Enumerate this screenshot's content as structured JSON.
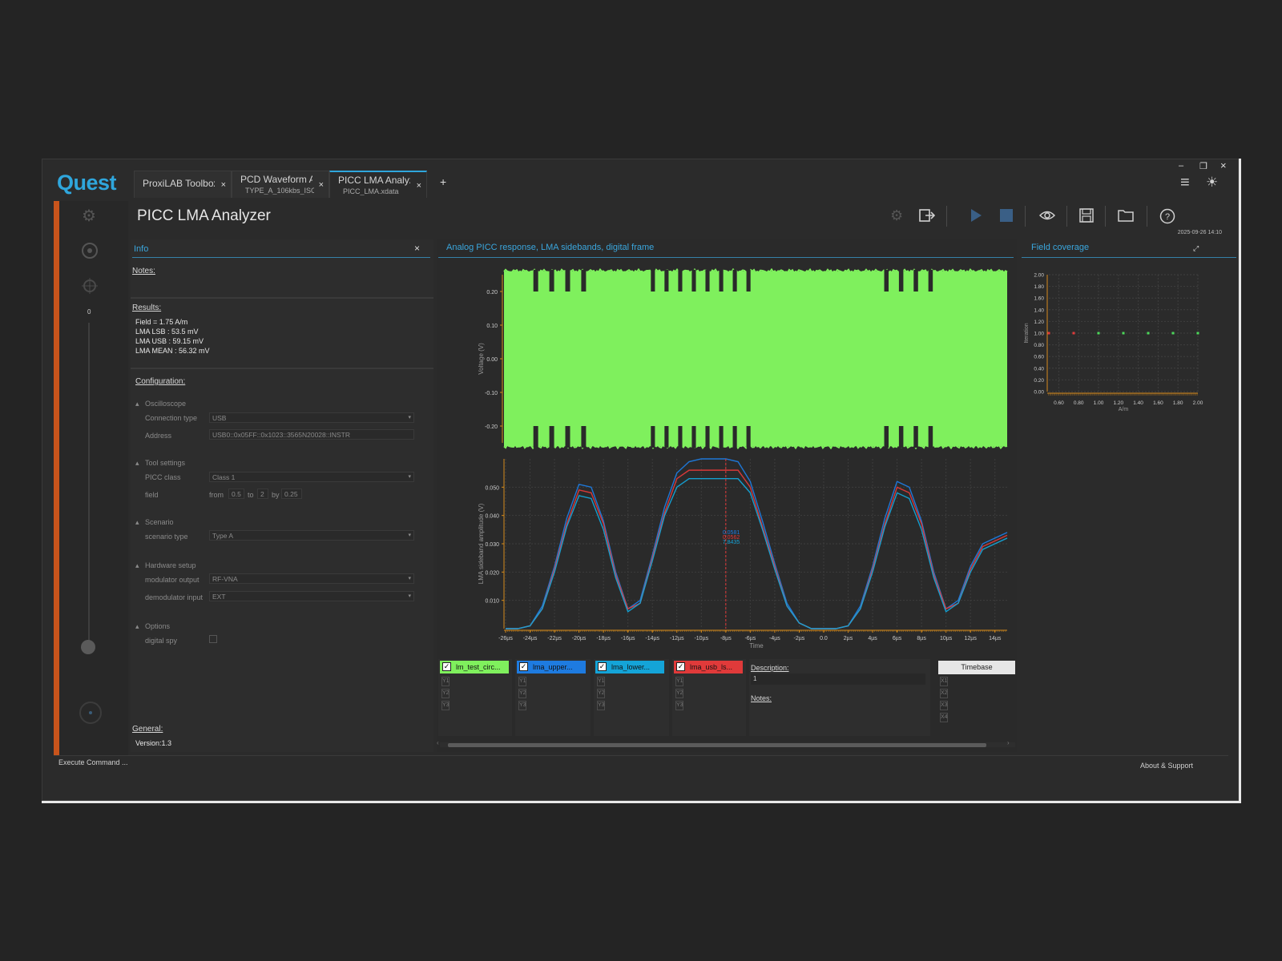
{
  "app": {
    "logo": "Quest",
    "tabs": [
      {
        "title": "ProxiLAB Toolbox",
        "subtitle": "",
        "close": "×"
      },
      {
        "title": "PCD Waveform A",
        "subtitle": "TYPE_A_106kbs_ISO_",
        "close": "×"
      },
      {
        "title": "PICC LMA Analyz",
        "subtitle": "PICC_LMA.xdata",
        "close": "×"
      }
    ],
    "add_tab": "+",
    "window": {
      "minimize": "–",
      "restore": "❐",
      "close": "×"
    },
    "menu_icon": "≡",
    "theme_icon": "☀"
  },
  "page": {
    "title": "PICC LMA Analyzer",
    "timestamp": "2025-09-26 14:10"
  },
  "toolbar": {
    "icons": [
      "gear-icon",
      "export-icon",
      "play-icon",
      "stop-icon",
      "eye-icon",
      "save-icon",
      "folder-icon",
      "help-icon"
    ]
  },
  "rail": {
    "slider_value": "0"
  },
  "info": {
    "title": "Info",
    "close": "×",
    "notes_label": "Notes:",
    "results_label": "Results:",
    "results": [
      "Field = 1.75 A/m",
      "LMA LSB : 53.5 mV",
      "LMA USB : 59.15 mV",
      "LMA MEAN : 56.32 mV"
    ],
    "configuration_label": "Configuration:",
    "oscilloscope": {
      "group": "Oscilloscope",
      "connection_type_label": "Connection type",
      "connection_type": "USB",
      "address_label": "Address",
      "address": "USB0::0x05FF::0x1023::3565N20028::INSTR"
    },
    "tool_settings": {
      "group": "Tool settings",
      "picc_class_label": "PICC class",
      "picc_class": "Class 1",
      "field_label": "field",
      "from_label": "from",
      "from": "0.5",
      "to_label": "to",
      "to": "2",
      "by_label": "by",
      "by": "0.25"
    },
    "scenario": {
      "group": "Scenario",
      "type_label": "scenario type",
      "type": "Type A"
    },
    "hardware": {
      "group": "Hardware setup",
      "mod_label": "modulator output",
      "mod": "RF-VNA",
      "demod_label": "demodulator input",
      "demod": "EXT"
    },
    "options": {
      "group": "Options",
      "spy_label": "digital spy"
    },
    "general_label": "General:",
    "version": "Version:1.3"
  },
  "chart_panel": {
    "title": "Analog PICC response, LMA sidebands, digital frame"
  },
  "field_panel": {
    "title": "Field coverage"
  },
  "legend": {
    "series": [
      {
        "name": "lm_test_circ...",
        "color": "#7ff05d",
        "ys": [
          "Y1",
          "Y2",
          "Y3"
        ]
      },
      {
        "name": "lma_upper...",
        "color": "#1e7be0",
        "ys": [
          "Y1",
          "Y2",
          "Y3"
        ]
      },
      {
        "name": "lma_lower...",
        "color": "#14a4d8",
        "ys": [
          "Y1",
          "Y2",
          "Y3"
        ]
      },
      {
        "name": "lma_usb_ls...",
        "color": "#e03a3a",
        "ys": [
          "Y1",
          "Y2",
          "Y3"
        ]
      }
    ],
    "description_label": "Description:",
    "description": "1",
    "notes_label": "Notes:",
    "timebase": "Timebase",
    "xs": [
      "X1",
      "X2",
      "X3",
      "X4"
    ]
  },
  "status": {
    "command": "Execute Command ...",
    "about": "About & Support"
  },
  "chart_data": [
    {
      "type": "area",
      "title": "",
      "ylabel": "Voltage (V)",
      "ylim": [
        -0.25,
        0.25
      ],
      "yticks": [
        "0.20",
        "0.10",
        "0.00",
        "-0.10",
        "-0.20"
      ],
      "yticks_values": [
        0.2,
        0.1,
        0.0,
        -0.1,
        -0.2
      ],
      "envelope_top": 0.26,
      "envelope_bottom": -0.26,
      "notch_top": 0.2,
      "notch_bottom": -0.2,
      "notch_clusters": [
        {
          "x_start": -23.8,
          "x_end": -18.6,
          "count": 4
        },
        {
          "x_start": -14.2,
          "x_end": -5.3,
          "count": 8
        },
        {
          "x_start": 4.8,
          "x_end": 9.6,
          "count": 4
        }
      ],
      "series": [
        {
          "name": "lm_test_circ...",
          "color": "#7ff05d"
        }
      ]
    },
    {
      "type": "line",
      "xlabel": "Time",
      "ylabel": "LMA sideband amplitude (V)",
      "ylim": [
        0,
        0.06
      ],
      "xlim": [
        -26,
        15
      ],
      "x_ticks": [
        "-26µs",
        "-24µs",
        "-22µs",
        "-20µs",
        "-18µs",
        "-16µs",
        "-14µs",
        "-12µs",
        "-10µs",
        "-8µs",
        "-6µs",
        "-4µs",
        "-2µs",
        "0.0",
        "2µs",
        "4µs",
        "6µs",
        "8µs",
        "10µs",
        "12µs",
        "14µs"
      ],
      "x_ticks_values": [
        -26,
        -24,
        -22,
        -20,
        -18,
        -16,
        -14,
        -12,
        -10,
        -8,
        -6,
        -4,
        -2,
        0,
        2,
        4,
        6,
        8,
        10,
        12,
        14
      ],
      "y_ticks": [
        "0.050",
        "0.040",
        "0.030",
        "0.020",
        "0.010"
      ],
      "y_ticks_values": [
        0.05,
        0.04,
        0.03,
        0.02,
        0.01
      ],
      "cursor_x": -8,
      "cursor_labels": [
        "0.0581",
        "0.0562",
        "7.8435"
      ],
      "x": [
        -26,
        -25,
        -24,
        -23,
        -22,
        -21,
        -20,
        -19,
        -18,
        -17,
        -16,
        -15,
        -14,
        -13,
        -12,
        -11,
        -10,
        -9,
        -8,
        -7,
        -6,
        -5,
        -4,
        -3,
        -2,
        -1,
        0,
        1,
        2,
        3,
        4,
        5,
        6,
        7,
        8,
        9,
        10,
        11,
        12,
        13,
        14,
        15
      ],
      "series": [
        {
          "name": "lma_upper...",
          "color": "#1e7be0",
          "values": [
            0.0,
            0.0,
            0.001,
            0.008,
            0.022,
            0.039,
            0.051,
            0.05,
            0.038,
            0.02,
            0.007,
            0.01,
            0.026,
            0.043,
            0.055,
            0.059,
            0.06,
            0.06,
            0.06,
            0.059,
            0.052,
            0.038,
            0.023,
            0.009,
            0.002,
            0.0,
            0.0,
            0.0,
            0.001,
            0.008,
            0.022,
            0.039,
            0.052,
            0.05,
            0.038,
            0.02,
            0.007,
            0.01,
            0.022,
            0.03,
            0.032,
            0.034
          ]
        },
        {
          "name": "lma_usb_ls...",
          "color": "#e03a3a",
          "values": [
            0.0,
            0.0,
            0.001,
            0.007,
            0.021,
            0.037,
            0.049,
            0.048,
            0.037,
            0.019,
            0.007,
            0.009,
            0.025,
            0.041,
            0.053,
            0.056,
            0.056,
            0.056,
            0.056,
            0.056,
            0.05,
            0.036,
            0.022,
            0.008,
            0.002,
            0.0,
            0.0,
            0.0,
            0.001,
            0.007,
            0.021,
            0.037,
            0.05,
            0.048,
            0.037,
            0.019,
            0.007,
            0.009,
            0.021,
            0.029,
            0.031,
            0.033
          ]
        },
        {
          "name": "lma_lower...",
          "color": "#14a4d8",
          "values": [
            0.0,
            0.0,
            0.001,
            0.007,
            0.02,
            0.036,
            0.047,
            0.046,
            0.035,
            0.018,
            0.006,
            0.009,
            0.024,
            0.04,
            0.05,
            0.053,
            0.053,
            0.053,
            0.053,
            0.053,
            0.048,
            0.035,
            0.021,
            0.008,
            0.002,
            0.0,
            0.0,
            0.0,
            0.001,
            0.007,
            0.02,
            0.036,
            0.048,
            0.046,
            0.035,
            0.018,
            0.006,
            0.009,
            0.02,
            0.028,
            0.03,
            0.032
          ]
        }
      ]
    },
    {
      "type": "scatter",
      "title": "",
      "xlabel": "A/m",
      "ylabel": "Iteration",
      "xlim": [
        0.5,
        2.0
      ],
      "ylim": [
        0,
        2
      ],
      "x_ticks": [
        "0.60",
        "0.80",
        "1.00",
        "1.20",
        "1.40",
        "1.60",
        "1.80",
        "2.00"
      ],
      "x_ticks_values": [
        0.6,
        0.8,
        1.0,
        1.2,
        1.4,
        1.6,
        1.8,
        2.0
      ],
      "y_ticks": [
        "2.00",
        "1.80",
        "1.60",
        "1.40",
        "1.20",
        "1.00",
        "0.80",
        "0.60",
        "0.40",
        "0.20",
        "0.00"
      ],
      "y_ticks_values": [
        2,
        1.8,
        1.6,
        1.4,
        1.2,
        1,
        0.8,
        0.6,
        0.4,
        0.2,
        0
      ],
      "points": [
        {
          "x": 0.5,
          "y": 1,
          "color": "#e03a3a"
        },
        {
          "x": 0.75,
          "y": 1,
          "color": "#e03a3a"
        },
        {
          "x": 1.0,
          "y": 1,
          "color": "#4cd85a"
        },
        {
          "x": 1.25,
          "y": 1,
          "color": "#4cd85a"
        },
        {
          "x": 1.5,
          "y": 1,
          "color": "#4cd85a"
        },
        {
          "x": 1.75,
          "y": 1,
          "color": "#4cd85a"
        },
        {
          "x": 2.0,
          "y": 1,
          "color": "#4cd85a"
        }
      ]
    }
  ]
}
